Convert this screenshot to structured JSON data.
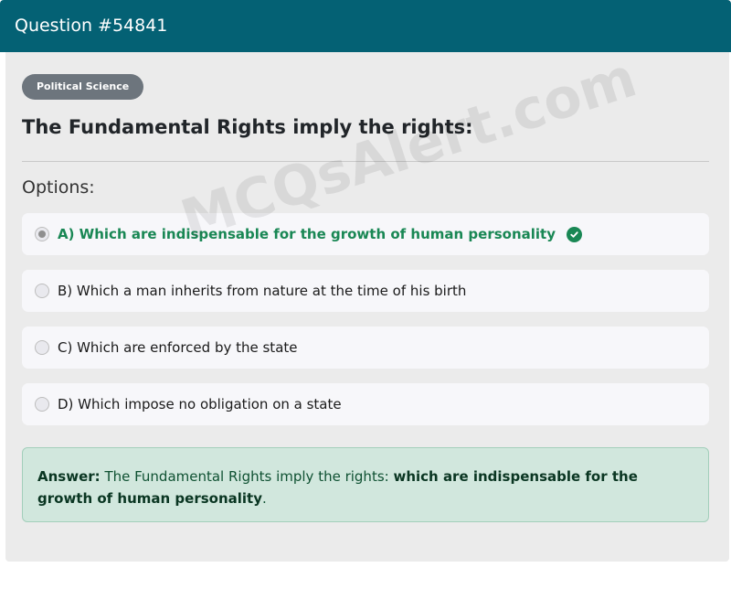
{
  "header": {
    "title": "Question #54841"
  },
  "badge": {
    "label": "Political Science"
  },
  "question": {
    "text": "The Fundamental Rights imply the rights:"
  },
  "options_label": "Options:",
  "options": [
    {
      "text": "A) Which are indispensable for the growth of human personality",
      "selected": true,
      "correct": true
    },
    {
      "text": "B) Which a man inherits from nature at the time of his birth",
      "selected": false,
      "correct": false
    },
    {
      "text": "C) Which are enforced by the state",
      "selected": false,
      "correct": false
    },
    {
      "text": "D) Which impose no obligation on a state",
      "selected": false,
      "correct": false
    }
  ],
  "answer": {
    "label": "Answer:",
    "prefix": "The Fundamental Rights imply the rights:",
    "answer_text": "which are indispensable for the growth of human personality",
    "suffix": "."
  },
  "watermark": "MCQsAlert.com",
  "colors": {
    "header": "#046174",
    "correct": "#198754",
    "answer_bg": "#d1e7dd"
  }
}
